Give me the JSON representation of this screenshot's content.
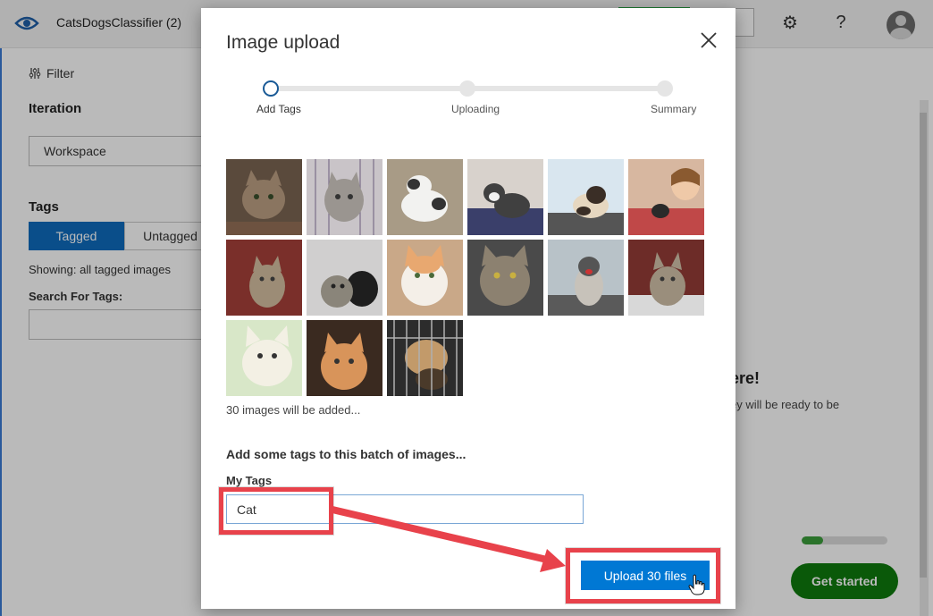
{
  "app": {
    "project_name": "CatsDogsClassifier (2)",
    "filter_label": "Filter",
    "iteration_heading": "Iteration",
    "iteration_value": "Workspace",
    "tags_heading": "Tags",
    "tagged_label": "Tagged",
    "untagged_label": "Untagged",
    "showing_text": "Showing: all tagged images",
    "search_tags_label": "Search For Tags:",
    "main_heading_fragment": "ere!",
    "main_text_fragment": "ey will be ready to be",
    "get_started_label": "Get started",
    "progress_fraction": 0.25
  },
  "modal": {
    "title": "Image upload",
    "steps": [
      {
        "label": "Add Tags",
        "state": "active"
      },
      {
        "label": "Uploading",
        "state": "pending"
      },
      {
        "label": "Summary",
        "state": "pending"
      }
    ],
    "image_count_text": "30 images will be added...",
    "batch_prompt": "Add some tags to this batch of images...",
    "my_tags_label": "My Tags",
    "tag_input_value": "Cat",
    "upload_label": "Upload 30 files"
  },
  "colors": {
    "primary": "#0078d4",
    "tagged_active": "#0f6cbd",
    "get_started": "#0e7a0d",
    "annotation": "#e8424b"
  }
}
